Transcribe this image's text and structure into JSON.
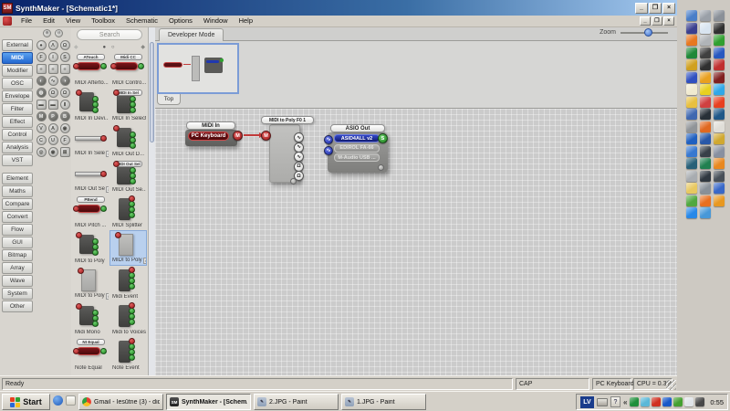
{
  "window": {
    "title": "SynthMaker - [Schematic1*]",
    "app_initials": "SM",
    "menus": [
      "File",
      "Edit",
      "View",
      "Toolbox",
      "Schematic",
      "Options",
      "Window",
      "Help"
    ]
  },
  "icons": {
    "minimize": "_",
    "restore": "❐",
    "close": "×",
    "filter_all": "⊕",
    "filter_none": "⊖",
    "pager_prev": "◆",
    "pager_next": "◆",
    "overflow": "»",
    "tray_expand": "«",
    "help": "?"
  },
  "sidebar": {
    "selected": "MIDI",
    "groups": [
      {
        "items": [
          "External",
          "MIDI",
          "Modifier",
          "OSC",
          "Envelope",
          "Filter",
          "Effect",
          "Control",
          "Analysis",
          "VST"
        ]
      },
      {
        "items": [
          "Element",
          "Maths",
          "Compare",
          "Convert",
          "Flow",
          "GUI",
          "Bitmap",
          "Array",
          "Wave",
          "System",
          "Other"
        ]
      }
    ]
  },
  "type_filters": [
    {
      "g": "●"
    },
    {
      "g": "Λ"
    },
    {
      "g": "Ω"
    },
    {
      "g": "F"
    },
    {
      "g": "I"
    },
    {
      "g": "S"
    },
    {
      "g": "≡",
      "sq": true
    },
    {
      "g": "≡",
      "sq": true
    },
    {
      "g": "≡",
      "sq": true
    },
    {
      "g": "◐",
      "dark": true
    },
    {
      "g": "∿"
    },
    {
      "g": "◑",
      "dark": true
    },
    {
      "g": "◍",
      "dark": true
    },
    {
      "g": "Ω"
    },
    {
      "g": "Ω"
    },
    {
      "g": "▬",
      "sq": true
    },
    {
      "g": "▬",
      "sq": true
    },
    {
      "g": "Ⅱ"
    },
    {
      "g": "M",
      "dark": true
    },
    {
      "g": "P",
      "dark": true
    },
    {
      "g": "B",
      "dark": true
    },
    {
      "g": "V"
    },
    {
      "g": "A"
    },
    {
      "g": "◉"
    },
    {
      "g": "C"
    },
    {
      "g": "U"
    },
    {
      "g": "F"
    },
    {
      "g": "◎"
    },
    {
      "g": "◉"
    },
    {
      "g": "⊠",
      "sq": true
    }
  ],
  "palette": {
    "search_placeholder": "Search",
    "page_dots": "● ○",
    "items": [
      {
        "label": "MIDI Afterto...",
        "thumb": "pill",
        "thumb_title": "ATouch"
      },
      {
        "label": "MIDI Contro...",
        "thumb": "pill",
        "thumb_title": "Midi CC"
      },
      {
        "label": "MIDI In Devi...",
        "thumb": "dark"
      },
      {
        "label": "MIDI In Select",
        "thumb": "dark2",
        "thumb_title": "MIDI In Sel"
      },
      {
        "label": "MIDI In Sele",
        "badge": true,
        "thumb": "slider"
      },
      {
        "label": "MIDI Out D...",
        "thumb": "dark"
      },
      {
        "label": "MIDI Out Se",
        "badge": true,
        "thumb": "slider"
      },
      {
        "label": "MIDI Out Se...",
        "thumb": "dark2",
        "thumb_title": "MIDI Out Sel"
      },
      {
        "label": "MIDI Pitch ...",
        "thumb": "pill",
        "thumb_title": "PBend"
      },
      {
        "label": "MIDI Splitter",
        "thumb": "tall"
      },
      {
        "label": "MIDI to Poly",
        "thumb": "dark"
      },
      {
        "label": "MIDI to Poly",
        "badge": true,
        "selected": true,
        "thumb": "tallgray"
      },
      {
        "label": "MIDI to Poly",
        "badge": true,
        "thumb": "tallgray"
      },
      {
        "label": "Midi Event",
        "thumb": "tall"
      },
      {
        "label": "Midi Mono",
        "thumb": "dark"
      },
      {
        "label": "Midi to Voices",
        "thumb": "tall"
      },
      {
        "label": "Note Equal",
        "thumb": "pill",
        "thumb_title": "Nt Equal"
      },
      {
        "label": "Note Event",
        "thumb": "tall"
      }
    ]
  },
  "main": {
    "tab": "Developer Mode",
    "navigator_tab": "Top",
    "zoom_label": "Zoom"
  },
  "canvas": {
    "modules": {
      "midi_in": {
        "title": "MIDI In",
        "device": "PC Keyboard",
        "out_connector": "M"
      },
      "midi_to_poly": {
        "title": "MIDI to Poly F0 1",
        "in_connector": "M",
        "outputs": [
          "∿",
          "∿",
          "∿",
          "Ω",
          "Ω"
        ]
      },
      "asio_out": {
        "title": "ASIO Out",
        "drivers": [
          {
            "label": "ASID4ALL v2",
            "selected": true
          },
          {
            "label": "EDIROL FA-66"
          },
          {
            "label": "M-Audio USB ..."
          }
        ],
        "out_connector": "S",
        "inputs": [
          "∿",
          "∿"
        ]
      }
    },
    "colors": {
      "midi_red": "#c23b3b",
      "stream_green": "#2fa32f",
      "input_blue": "#1f2fa8",
      "selected_driver": "#1a2aa0"
    }
  },
  "statusbar": {
    "ready": "Ready",
    "cap": "CAP",
    "device": "PC Keyboard",
    "cpu": "CPU = 0.3%"
  },
  "taskbar": {
    "start": "Start",
    "tasks": [
      {
        "label": "Gmail - Iesūtne (3) - didzi...",
        "icon": "chrome"
      },
      {
        "label": "SynthMaker - [Schem...",
        "icon": "sm",
        "active": true
      },
      {
        "label": "2.JPG - Paint",
        "icon": "paint"
      },
      {
        "label": "1.JPG - Paint",
        "icon": "paint"
      }
    ],
    "tray": {
      "lang": "LV",
      "clock": "0:55"
    },
    "tray_icon_colors": [
      "#1f8f3a",
      "#5bb8d8",
      "#d03020",
      "#1858c8",
      "#44a030",
      "#e0e4e8",
      "#484848"
    ]
  },
  "desktop": {
    "icon_colors": [
      "#4a7ec8",
      "#9aa0a8",
      "#8a9098",
      "#3a3f8f",
      "#d8e4f0",
      "#303030",
      "#e87820",
      "#b0b4b8",
      "#30a030",
      "#208838",
      "#404040",
      "#2858c0",
      "#d0a020",
      "#303030",
      "#c03030",
      "#3050c0",
      "#e8a020",
      "#802020",
      "#f0ead0",
      "#e8d020",
      "#30a8e8",
      "#e8c040",
      "#d04040",
      "#e84020",
      "#4068b0",
      "#283038",
      "#205888",
      "#909498",
      "#e06820",
      "#e0ded8",
      "#2060c0",
      "#2858a8",
      "#d0a830",
      "#3878d0",
      "#384048",
      "#8890a0",
      "#286078",
      "#208050",
      "#e88820",
      "#a8acb0",
      "#303840",
      "#485058",
      "#e8c860",
      "#889098",
      "#3868c8",
      "#50a840",
      "#e87020",
      "#e89820",
      "#2888e8",
      "#4898d8"
    ]
  }
}
